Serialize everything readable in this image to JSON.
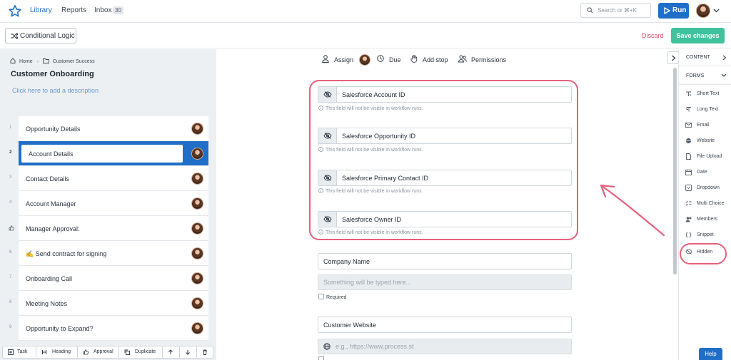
{
  "topbar": {
    "nav": [
      "Library",
      "Reports",
      "Inbox"
    ],
    "inbox_count": "30",
    "search_placeholder": "Search or ⌘+K",
    "run_label": "Run"
  },
  "subbar": {
    "conditional_logic": "Conditional Logic",
    "discard": "Discard",
    "save": "Save changes"
  },
  "left": {
    "breadcrumb": [
      "Home",
      "Customer Success"
    ],
    "title": "Customer Onboarding",
    "description_placeholder": "Click here to add a description",
    "steps": [
      {
        "num": "1",
        "label": "Opportunity Details"
      },
      {
        "num": "2",
        "label": "Account Details"
      },
      {
        "num": "3",
        "label": "Contact Details"
      },
      {
        "num": "4",
        "label": "Account Manager"
      },
      {
        "num": "",
        "label": "Manager Approval:"
      },
      {
        "num": "6",
        "label": "✍️ Send contract for signing"
      },
      {
        "num": "7",
        "label": "Onboarding Call"
      },
      {
        "num": "8",
        "label": "Meeting Notes"
      },
      {
        "num": "9",
        "label": "Opportunity to Expand?"
      }
    ],
    "step_actions": [
      "Task",
      "Heading",
      "Approval",
      "Duplicate"
    ]
  },
  "toolbar": {
    "assign": "Assign",
    "due": "Due",
    "add_stop": "Add stop",
    "permissions": "Permissions"
  },
  "form": {
    "hidden_fields": [
      "Salesforce Account ID",
      "Salesforce Opportunity ID",
      "Salesforce Primary Contact ID",
      "Salesforce Owner ID"
    ],
    "hidden_hint": "This field will not be visible in workflow runs.",
    "company_label": "Company Name",
    "company_placeholder": "Something will be typed here...",
    "required": "Required",
    "website_label": "Customer Website",
    "website_placeholder": "e.g., https://www.process.st"
  },
  "right": {
    "content": "CONTENT",
    "forms": "FORMS",
    "items": [
      "Short Text",
      "Long Text",
      "Email",
      "Website",
      "File Upload",
      "Date",
      "Dropdown",
      "Multi Choice",
      "Members",
      "Snippet",
      "Hidden"
    ]
  },
  "help": "Help",
  "colors": {
    "accent": "#1f6fc9",
    "save": "#3fc39c",
    "highlight": "#e8607c"
  }
}
